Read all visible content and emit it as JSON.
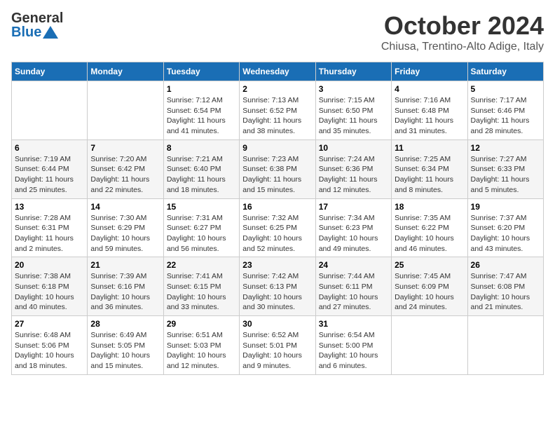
{
  "header": {
    "logo_line1": "General",
    "logo_line2": "Blue",
    "month": "October 2024",
    "location": "Chiusa, Trentino-Alto Adige, Italy"
  },
  "days_of_week": [
    "Sunday",
    "Monday",
    "Tuesday",
    "Wednesday",
    "Thursday",
    "Friday",
    "Saturday"
  ],
  "weeks": [
    [
      {
        "day": "",
        "detail": ""
      },
      {
        "day": "",
        "detail": ""
      },
      {
        "day": "1",
        "detail": "Sunrise: 7:12 AM\nSunset: 6:54 PM\nDaylight: 11 hours and 41 minutes."
      },
      {
        "day": "2",
        "detail": "Sunrise: 7:13 AM\nSunset: 6:52 PM\nDaylight: 11 hours and 38 minutes."
      },
      {
        "day": "3",
        "detail": "Sunrise: 7:15 AM\nSunset: 6:50 PM\nDaylight: 11 hours and 35 minutes."
      },
      {
        "day": "4",
        "detail": "Sunrise: 7:16 AM\nSunset: 6:48 PM\nDaylight: 11 hours and 31 minutes."
      },
      {
        "day": "5",
        "detail": "Sunrise: 7:17 AM\nSunset: 6:46 PM\nDaylight: 11 hours and 28 minutes."
      }
    ],
    [
      {
        "day": "6",
        "detail": "Sunrise: 7:19 AM\nSunset: 6:44 PM\nDaylight: 11 hours and 25 minutes."
      },
      {
        "day": "7",
        "detail": "Sunrise: 7:20 AM\nSunset: 6:42 PM\nDaylight: 11 hours and 22 minutes."
      },
      {
        "day": "8",
        "detail": "Sunrise: 7:21 AM\nSunset: 6:40 PM\nDaylight: 11 hours and 18 minutes."
      },
      {
        "day": "9",
        "detail": "Sunrise: 7:23 AM\nSunset: 6:38 PM\nDaylight: 11 hours and 15 minutes."
      },
      {
        "day": "10",
        "detail": "Sunrise: 7:24 AM\nSunset: 6:36 PM\nDaylight: 11 hours and 12 minutes."
      },
      {
        "day": "11",
        "detail": "Sunrise: 7:25 AM\nSunset: 6:34 PM\nDaylight: 11 hours and 8 minutes."
      },
      {
        "day": "12",
        "detail": "Sunrise: 7:27 AM\nSunset: 6:33 PM\nDaylight: 11 hours and 5 minutes."
      }
    ],
    [
      {
        "day": "13",
        "detail": "Sunrise: 7:28 AM\nSunset: 6:31 PM\nDaylight: 11 hours and 2 minutes."
      },
      {
        "day": "14",
        "detail": "Sunrise: 7:30 AM\nSunset: 6:29 PM\nDaylight: 10 hours and 59 minutes."
      },
      {
        "day": "15",
        "detail": "Sunrise: 7:31 AM\nSunset: 6:27 PM\nDaylight: 10 hours and 56 minutes."
      },
      {
        "day": "16",
        "detail": "Sunrise: 7:32 AM\nSunset: 6:25 PM\nDaylight: 10 hours and 52 minutes."
      },
      {
        "day": "17",
        "detail": "Sunrise: 7:34 AM\nSunset: 6:23 PM\nDaylight: 10 hours and 49 minutes."
      },
      {
        "day": "18",
        "detail": "Sunrise: 7:35 AM\nSunset: 6:22 PM\nDaylight: 10 hours and 46 minutes."
      },
      {
        "day": "19",
        "detail": "Sunrise: 7:37 AM\nSunset: 6:20 PM\nDaylight: 10 hours and 43 minutes."
      }
    ],
    [
      {
        "day": "20",
        "detail": "Sunrise: 7:38 AM\nSunset: 6:18 PM\nDaylight: 10 hours and 40 minutes."
      },
      {
        "day": "21",
        "detail": "Sunrise: 7:39 AM\nSunset: 6:16 PM\nDaylight: 10 hours and 36 minutes."
      },
      {
        "day": "22",
        "detail": "Sunrise: 7:41 AM\nSunset: 6:15 PM\nDaylight: 10 hours and 33 minutes."
      },
      {
        "day": "23",
        "detail": "Sunrise: 7:42 AM\nSunset: 6:13 PM\nDaylight: 10 hours and 30 minutes."
      },
      {
        "day": "24",
        "detail": "Sunrise: 7:44 AM\nSunset: 6:11 PM\nDaylight: 10 hours and 27 minutes."
      },
      {
        "day": "25",
        "detail": "Sunrise: 7:45 AM\nSunset: 6:09 PM\nDaylight: 10 hours and 24 minutes."
      },
      {
        "day": "26",
        "detail": "Sunrise: 7:47 AM\nSunset: 6:08 PM\nDaylight: 10 hours and 21 minutes."
      }
    ],
    [
      {
        "day": "27",
        "detail": "Sunrise: 6:48 AM\nSunset: 5:06 PM\nDaylight: 10 hours and 18 minutes."
      },
      {
        "day": "28",
        "detail": "Sunrise: 6:49 AM\nSunset: 5:05 PM\nDaylight: 10 hours and 15 minutes."
      },
      {
        "day": "29",
        "detail": "Sunrise: 6:51 AM\nSunset: 5:03 PM\nDaylight: 10 hours and 12 minutes."
      },
      {
        "day": "30",
        "detail": "Sunrise: 6:52 AM\nSunset: 5:01 PM\nDaylight: 10 hours and 9 minutes."
      },
      {
        "day": "31",
        "detail": "Sunrise: 6:54 AM\nSunset: 5:00 PM\nDaylight: 10 hours and 6 minutes."
      },
      {
        "day": "",
        "detail": ""
      },
      {
        "day": "",
        "detail": ""
      }
    ]
  ]
}
